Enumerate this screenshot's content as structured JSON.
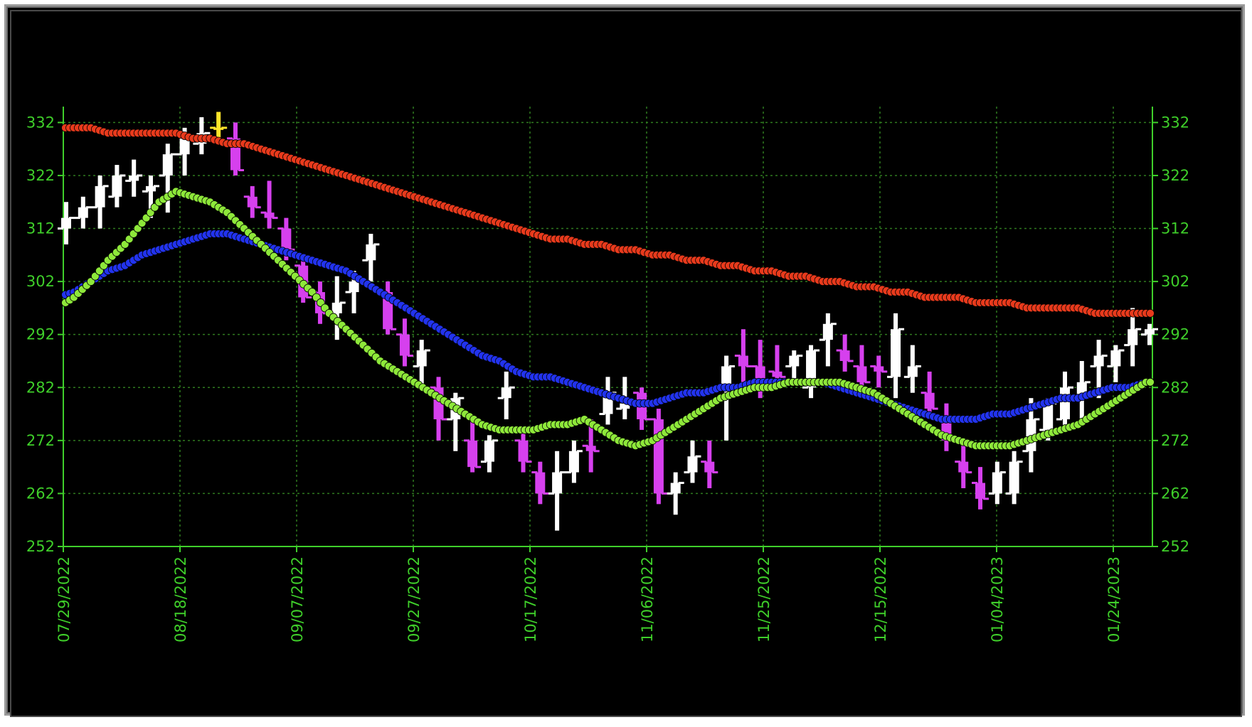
{
  "chart_data": {
    "type": "ohlc-with-moving-averages",
    "x_tick_labels": [
      "07/29/2022",
      "08/18/2022",
      "09/07/2022",
      "09/27/2022",
      "10/17/2022",
      "11/06/2022",
      "11/25/2022",
      "12/15/2022",
      "01/04/2023",
      "01/24/2023"
    ],
    "y_ticks": [
      252,
      262,
      272,
      282,
      292,
      302,
      312,
      322,
      332
    ],
    "ylim": [
      252,
      335
    ],
    "grid": true,
    "grid_style": "dotted",
    "colors": {
      "background": "#000000",
      "axis": "#3fcf2a",
      "grid": "#2f7a1f",
      "up_bar": "#ffffff",
      "down_bar": "#d640ee",
      "highlight_bar": "#ffe52a",
      "ma_long": "#e83a1c",
      "ma_mid": "#2233ee",
      "ma_short": "#8ee83a"
    },
    "price_bars": [
      [
        312,
        309,
        317,
        314
      ],
      [
        314,
        312,
        318,
        316
      ],
      [
        316,
        312,
        322,
        320
      ],
      [
        318,
        316,
        324,
        322
      ],
      [
        321,
        318,
        325,
        322
      ],
      [
        319,
        314,
        322,
        320
      ],
      [
        322,
        315,
        328,
        326
      ],
      [
        326,
        322,
        331,
        329
      ],
      [
        328,
        326,
        333,
        330
      ],
      [
        331,
        329,
        334,
        331
      ],
      [
        329,
        322,
        332,
        323
      ],
      [
        318,
        314,
        320,
        316
      ],
      [
        315,
        312,
        321,
        314
      ],
      [
        312,
        306,
        314,
        308
      ],
      [
        305,
        298,
        306,
        299
      ],
      [
        300,
        294,
        302,
        296
      ],
      [
        296,
        291,
        303,
        298
      ],
      [
        300,
        296,
        304,
        302
      ],
      [
        306,
        302,
        311,
        309
      ],
      [
        300,
        292,
        302,
        293
      ],
      [
        292,
        286,
        295,
        288
      ],
      [
        286,
        282,
        291,
        289
      ],
      [
        282,
        272,
        284,
        276
      ],
      [
        276,
        270,
        281,
        280
      ],
      [
        272,
        266,
        276,
        267
      ],
      [
        268,
        266,
        273,
        272
      ],
      [
        280,
        276,
        285,
        282
      ],
      [
        272,
        266,
        274,
        268
      ],
      [
        266,
        260,
        268,
        262
      ],
      [
        262,
        255,
        270,
        266
      ],
      [
        266,
        264,
        272,
        270
      ],
      [
        271,
        266,
        276,
        270
      ],
      [
        277,
        275,
        284,
        281
      ],
      [
        278,
        276,
        284,
        279
      ],
      [
        281,
        274,
        282,
        276
      ],
      [
        276,
        260,
        278,
        262
      ],
      [
        262,
        258,
        266,
        264
      ],
      [
        266,
        264,
        272,
        269
      ],
      [
        268,
        263,
        272,
        266
      ],
      [
        282,
        272,
        288,
        286
      ],
      [
        288,
        282,
        293,
        286
      ],
      [
        286,
        280,
        291,
        283
      ],
      [
        285,
        282,
        290,
        284
      ],
      [
        286,
        283,
        289,
        288
      ],
      [
        282,
        280,
        290,
        289
      ],
      [
        291,
        286,
        296,
        294
      ],
      [
        289,
        285,
        292,
        287
      ],
      [
        286,
        282,
        290,
        283
      ],
      [
        286,
        282,
        288,
        285
      ],
      [
        284,
        280,
        296,
        293
      ],
      [
        284,
        281,
        290,
        286
      ],
      [
        281,
        276,
        285,
        278
      ],
      [
        276,
        270,
        279,
        272
      ],
      [
        268,
        263,
        272,
        266
      ],
      [
        264,
        259,
        267,
        261
      ],
      [
        262,
        260,
        268,
        266
      ],
      [
        262,
        260,
        270,
        268
      ],
      [
        270,
        266,
        280,
        276
      ],
      [
        274,
        272,
        280,
        279
      ],
      [
        276,
        274,
        285,
        282
      ],
      [
        280,
        276,
        287,
        283
      ],
      [
        286,
        280,
        291,
        288
      ],
      [
        286,
        283,
        290,
        289
      ],
      [
        290,
        286,
        297,
        293
      ],
      [
        292,
        290,
        294,
        293
      ]
    ],
    "highlighted_bar_index": 9,
    "series": [
      {
        "color": "#e83a1c",
        "values": [
          331,
          331,
          331,
          330,
          330,
          330,
          330,
          330,
          329,
          329,
          328,
          328,
          327,
          326,
          325,
          324,
          323,
          322,
          321,
          320,
          319,
          318,
          317,
          316,
          315,
          314,
          313,
          312,
          311,
          310,
          310,
          309,
          309,
          308,
          308,
          307,
          307,
          306,
          306,
          305,
          305,
          304,
          304,
          303,
          303,
          302,
          302,
          301,
          301,
          300,
          300,
          299,
          299,
          299,
          298,
          298,
          298,
          297,
          297,
          297,
          297,
          296,
          296,
          296,
          296
        ]
      },
      {
        "color": "#2233ee",
        "values": [
          299,
          300,
          302,
          304,
          305,
          307,
          308,
          309,
          310,
          311,
          311,
          310,
          309,
          308,
          307,
          306,
          305,
          304,
          302,
          300,
          298,
          296,
          294,
          292,
          290,
          288,
          287,
          285,
          284,
          284,
          283,
          282,
          281,
          280,
          279,
          279,
          280,
          281,
          281,
          282,
          282,
          283,
          283,
          283,
          283,
          283,
          282,
          281,
          280,
          279,
          278,
          277,
          276,
          276,
          276,
          277,
          277,
          278,
          279,
          280,
          280,
          281,
          282,
          282,
          283
        ]
      },
      {
        "color": "#8ee83a",
        "values": [
          297,
          299,
          302,
          306,
          309,
          313,
          317,
          319,
          318,
          317,
          315,
          312,
          309,
          306,
          303,
          300,
          296,
          293,
          290,
          287,
          285,
          283,
          281,
          279,
          277,
          275,
          274,
          274,
          274,
          275,
          275,
          276,
          274,
          272,
          271,
          272,
          274,
          276,
          278,
          280,
          281,
          282,
          282,
          283,
          283,
          283,
          283,
          282,
          281,
          279,
          277,
          275,
          273,
          272,
          271,
          271,
          271,
          272,
          273,
          274,
          275,
          277,
          279,
          281,
          283
        ]
      }
    ]
  }
}
